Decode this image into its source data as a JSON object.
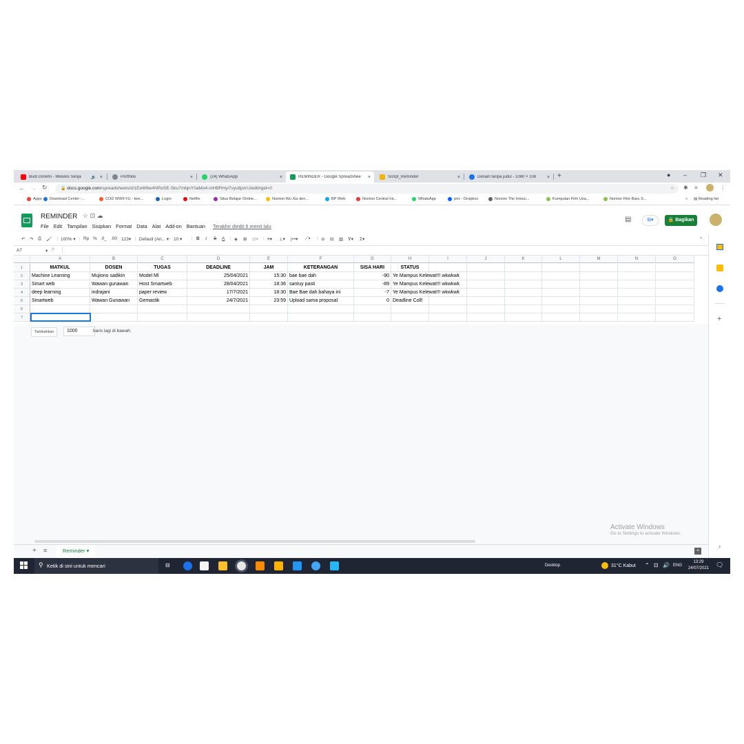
{
  "browser": {
    "tabs": [
      {
        "label": "Budi Doremi - Melukis Senja",
        "color": "#ff0000",
        "extra": "🔊"
      },
      {
        "label": "Portfolio",
        "color": "#80868b",
        "extra": ""
      },
      {
        "label": "(24) WhatsApp",
        "color": "#25d366",
        "extra": ""
      },
      {
        "label": "REMINDER - Google Spreadshee",
        "color": "#0f9d58",
        "extra": ""
      },
      {
        "label": "Script_Reminder",
        "color": "#f4b400",
        "extra": ""
      },
      {
        "label": "Desain tanpa judul - 1080 × 108",
        "color": "#1a73e8",
        "extra": ""
      }
    ],
    "new_tab": "+",
    "url_host": "docs.google.com",
    "url_path": "/spreadsheets/d/1EeW6w4NRoSE-Sku7mbjnY0aMo4-mHBRHyi7vyu8pzrU/edit#gid=0",
    "bookmarks": [
      {
        "label": "Apps",
        "color": "#ea4335"
      },
      {
        "label": "Download Center -...",
        "color": "#1a73e8"
      },
      {
        "label": "COD WWII FU - kee...",
        "color": "#ff5722"
      },
      {
        "label": "Login",
        "color": "#1565c0"
      },
      {
        "label": "Netflix",
        "color": "#e50914"
      },
      {
        "label": "Situs Belajar Online...",
        "color": "#9c27b0"
      },
      {
        "label": "Nonton Wu Xia den...",
        "color": "#fbbc04"
      },
      {
        "label": "BP Web",
        "color": "#03a9f4"
      },
      {
        "label": "Nonton Central Int...",
        "color": "#e53935"
      },
      {
        "label": "WhatsApp",
        "color": "#25d366"
      },
      {
        "label": "priv - Dropbox",
        "color": "#0061ff"
      },
      {
        "label": "Nonton The Intouc...",
        "color": "#5f6368"
      },
      {
        "label": "Kumpulan Film Usa...",
        "color": "#8bc34a"
      },
      {
        "label": "Nonton Film Baru S...",
        "color": "#8bc34a"
      }
    ],
    "more": "»",
    "reading_list": "Reading list"
  },
  "doc": {
    "title": "REMINDER",
    "menu": [
      "File",
      "Edit",
      "Tampilan",
      "Sisipkan",
      "Format",
      "Data",
      "Alat",
      "Add-on",
      "Bantuan"
    ],
    "last_edit": "Terakhir diedit 6 menit lalu",
    "share_label": "🔒 Bagikan"
  },
  "toolbar": {
    "zoom": "100%",
    "currency": "Rp",
    "percent": "%",
    "dec1": ".0_",
    "dec2": ".00",
    "format": "123▾",
    "font": "Default (Ari...",
    "font_size": "10"
  },
  "formula_bar": {
    "cell_ref": "A7",
    "fx": "fx"
  },
  "sheet": {
    "columns": [
      "A",
      "B",
      "C",
      "D",
      "E",
      "F",
      "G",
      "H",
      "I",
      "J",
      "K",
      "L",
      "M",
      "N",
      "O"
    ],
    "rows": [
      "1",
      "2",
      "3",
      "4",
      "5",
      "6",
      "7"
    ],
    "header": [
      "MATKUL",
      "DOSEN",
      "TUGAS",
      "DEADLINE",
      "JAM",
      "KETERANGAN",
      "SISA HARI",
      "STATUS"
    ],
    "data": [
      [
        "Machine Learning",
        "Mujiono sadikin",
        "Model Ml",
        "25/04/2021",
        "15:30",
        "bae bae dah",
        "-90",
        "Ye Mampus Kelewat!!! wkwkwk"
      ],
      [
        "Smart web",
        "Wawan gunawan",
        "Host Smartweb",
        "28/04/2021",
        "18:36",
        "santuy pasti",
        "-89",
        "Ye Mampus Kelewat!!! wkwkwk"
      ],
      [
        "deep learning",
        "indrajani",
        "paper review",
        "17/7/2021",
        "18:30",
        "Bae Bae dah bahaya ini",
        "-7",
        "Ye Mampus Kelewat!!! wkwkwk"
      ],
      [
        "Smartweb",
        "Wawan Gunawan",
        "Gemastik",
        "24/7/2021",
        "23:59",
        "Upload sama proposal",
        "0",
        "Deadline Coll!"
      ]
    ],
    "add_button": "Tambahkan",
    "add_count": "1000",
    "add_suffix": "baris lagi di bawah.",
    "sheet_tab": "Reminder"
  },
  "watermark": {
    "title": "Activate Windows",
    "subtitle": "Go to Settings to activate Windows."
  },
  "taskbar": {
    "search_placeholder": "Ketik di sini untuk mencari",
    "desktop": "Desktop",
    "weather": "31°C  Kabut",
    "lang": "ENG",
    "time": "13:29",
    "date": "24/07/2021"
  }
}
